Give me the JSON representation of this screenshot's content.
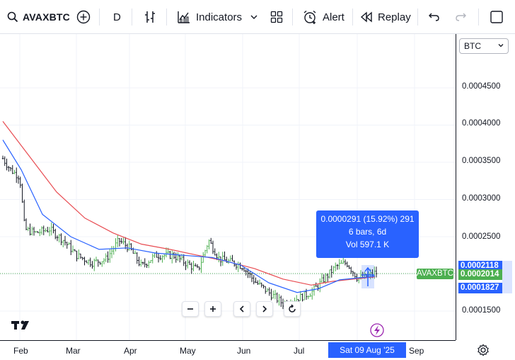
{
  "toolbar": {
    "symbol": "AVAXBTC",
    "interval": "D",
    "indicators_label": "Indicators",
    "alert_label": "Alert",
    "replay_label": "Replay"
  },
  "price_axis": {
    "currency": "BTC",
    "ticks": [
      "0.0004500",
      "0.0004000",
      "0.0003500",
      "0.0003000",
      "0.0002500",
      "0.0001500"
    ],
    "tags": {
      "high": "0.0002118",
      "current": "0.0002014",
      "low": "0.0001827"
    },
    "symbol_tag": "AVAXBTC"
  },
  "time_axis": {
    "months": [
      "Feb",
      "Mar",
      "Apr",
      "May",
      "Jun",
      "Jul",
      "Sep"
    ],
    "date_tag": "Sat 09 Aug '25"
  },
  "measure": {
    "line1": "0.0000291 (15.92%) 291",
    "line2": "6 bars, 6d",
    "line3": "Vol 597.1 K"
  },
  "colors": {
    "accent": "#2962ff",
    "ma_red": "#e84c52",
    "ma_blue": "#2962ff",
    "up": "#4caf50",
    "down": "#131722"
  },
  "chart_data": {
    "type": "line",
    "series": [
      {
        "name": "",
        "x": [
          "Jan 24",
          "Feb 1",
          "Feb 10",
          "Feb 20",
          "Mar 1",
          "Mar 10",
          "Mar 20",
          "Apr 1",
          "Apr 10",
          "Apr 20",
          "May 1",
          "May 10",
          "May 20",
          "Jun 1",
          "Jun 10",
          "Jun 20",
          "Jul 1",
          "Jul 10",
          "Jul 20",
          "Aug 1",
          "Aug 9"
        ],
        "values": [
          0.000355,
          0.00033,
          0.00026,
          0.000255,
          0.00022,
          0.000215,
          0.000225,
          0.00024,
          0.00021,
          0.000225,
          0.000215,
          0.000235,
          0.000205,
          0.00019,
          0.00017,
          0.00016,
          0.000165,
          0.00018,
          0.000215,
          0.000195,
          0.0002014
        ]
      }
    ]
  }
}
